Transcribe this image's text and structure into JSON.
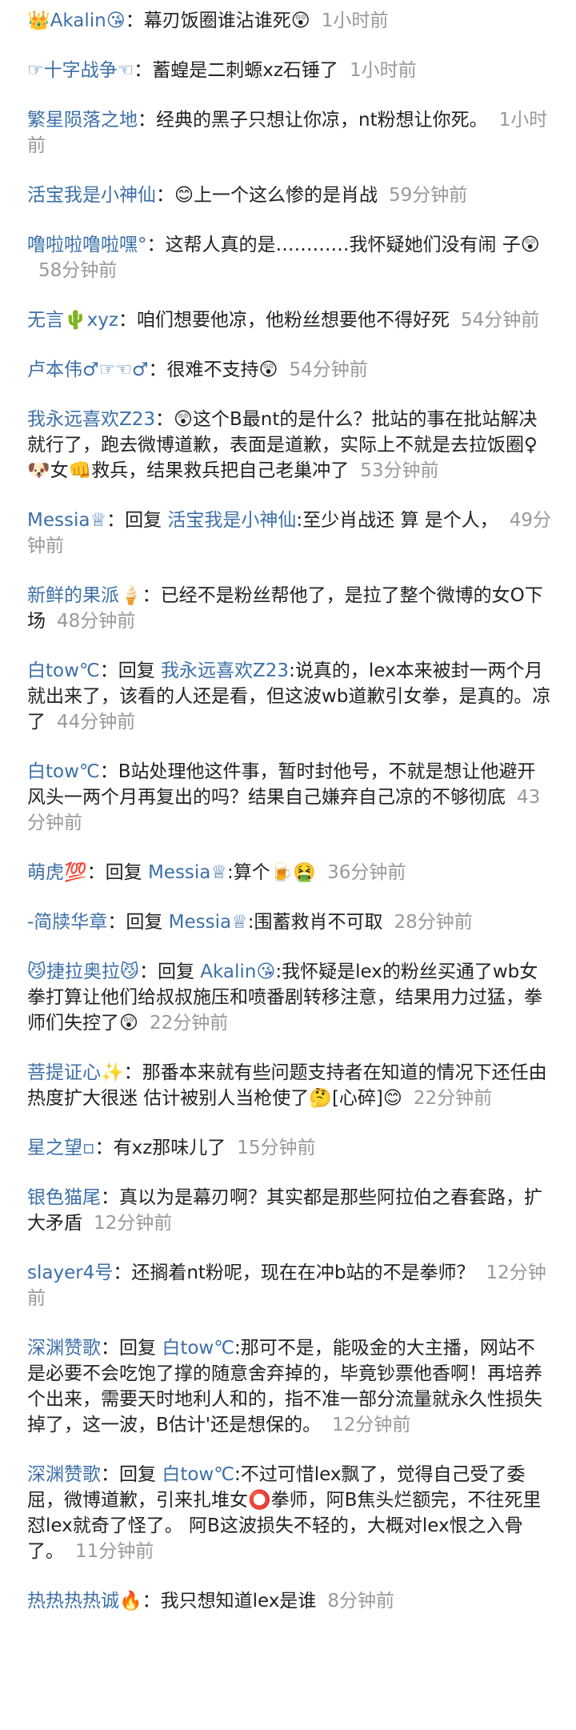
{
  "comments": [
    {
      "name": "👑Akalin😘",
      "sep": "：",
      "reply_label": "",
      "reply_to": "",
      "text": "幕刃饭圈谁沾谁死😲",
      "time": "1小时前"
    },
    {
      "name": "☞十字战争☜",
      "sep": "：",
      "reply_label": "",
      "reply_to": "",
      "text": "蓄蝗是二刺螈xz石锤了",
      "time": "1小时前"
    },
    {
      "name": "繁星陨落之地",
      "sep": "：",
      "reply_label": "",
      "reply_to": "",
      "text": "经典的黑子只想让你凉，nt粉想让你死。",
      "time": "1小时前"
    },
    {
      "name": "活宝我是小神仙",
      "sep": "：",
      "reply_label": "",
      "reply_to": "",
      "text": "😊上一个这么惨的是肖战",
      "time": "59分钟前"
    },
    {
      "name": "噜啦啦噜啦嘿°",
      "sep": "：",
      "reply_label": "",
      "reply_to": "",
      "text": "这帮人真的是…………我怀疑她们没有闹 子😲",
      "time": "58分钟前"
    },
    {
      "name": "无言🌵xyz",
      "sep": "：",
      "reply_label": "",
      "reply_to": "",
      "text": "咱们想要他凉，他粉丝想要他不得好死",
      "time": "54分钟前"
    },
    {
      "name": "卢本伟♂☞☜♂",
      "sep": "：",
      "reply_label": "",
      "reply_to": "",
      "text": "很难不支持😲",
      "time": "54分钟前"
    },
    {
      "name": "我永远喜欢Z23",
      "sep": "：",
      "reply_label": "",
      "reply_to": "",
      "text": "😲这个B最nt的是什么？批站的事在批站解决就行了，跑去微博道歉，表面是道歉，实际上不就是去拉饭圈♀🐶女👊救兵，结果救兵把自己老巢冲了",
      "time": "53分钟前"
    },
    {
      "name": "Messia♕",
      "sep": "：",
      "reply_label": "回复 ",
      "reply_to": "活宝我是小神仙",
      "text": ":至少肖战还 算 是个人，",
      "time": "49分钟前"
    },
    {
      "name": "新鲜的果派🍦",
      "sep": "：",
      "reply_label": "",
      "reply_to": "",
      "text": "已经不是粉丝帮他了，是拉了整个微博的女O下场",
      "time": "48分钟前"
    },
    {
      "name": "白tow℃",
      "sep": "：",
      "reply_label": "回复 ",
      "reply_to": "我永远喜欢Z23",
      "text": ":说真的，lex本来被封一两个月就出来了，该看的人还是看，但这波wb道歉引女拳，是真的。凉了",
      "time": "44分钟前"
    },
    {
      "name": "白tow℃",
      "sep": "：",
      "reply_label": "",
      "reply_to": "",
      "text": "B站处理他这件事，暂时封他号，不就是想让他避开风头一两个月再复出的吗？结果自己嫌弃自己凉的不够彻底",
      "time": "43分钟前"
    },
    {
      "name": "萌虎💯",
      "sep": "：",
      "reply_label": "回复 ",
      "reply_to": "Messia♕",
      "text": ":算个🍺🤮",
      "time": "36分钟前"
    },
    {
      "name": "-简牍华章",
      "sep": "：",
      "reply_label": "回复 ",
      "reply_to": "Messia♕",
      "text": ":围蓄救肖不可取",
      "time": "28分钟前"
    },
    {
      "name": "😼捷拉奥拉😼",
      "sep": "：",
      "reply_label": "回复 ",
      "reply_to": "Akalin😘",
      "text": ":我怀疑是lex的粉丝买通了wb女拳打算让他们给叔叔施压和喷番剧转移注意，结果用力过猛，拳师们失控了😲",
      "time": "22分钟前"
    },
    {
      "name": "菩提证心✨",
      "sep": "：",
      "reply_label": "",
      "reply_to": "",
      "text": "那番本来就有些问题支持者在知道的情况下还任由热度扩大很迷 估计被别人当枪使了🤔[心碎]😊",
      "time": "22分钟前"
    },
    {
      "name": "星之望▫",
      "sep": "：",
      "reply_label": "",
      "reply_to": "",
      "text": "有xz那味儿了",
      "time": "15分钟前"
    },
    {
      "name": "银色猫尾",
      "sep": "：",
      "reply_label": "",
      "reply_to": "",
      "text": "真以为是幕刃啊？其实都是那些阿拉伯之春套路，扩大矛盾",
      "time": "12分钟前"
    },
    {
      "name": "slayer4号",
      "sep": "：",
      "reply_label": "",
      "reply_to": "",
      "text": "还搁着nt粉呢，现在在冲b站的不是拳师？",
      "time": "12分钟前"
    },
    {
      "name": "深渊赞歌",
      "sep": "：",
      "reply_label": "回复 ",
      "reply_to": "白tow℃",
      "text": ":那可不是，能吸金的大主播，网站不是必要不会吃饱了撑的随意舍弃掉的，毕竟钞票他香啊！再培养个出来，需要天时地利人和的，指不准一部分流量就永久性损失掉了，这一波，B估计'还是想保的。",
      "time": "12分钟前"
    },
    {
      "name": "深渊赞歌",
      "sep": "：",
      "reply_label": "回复 ",
      "reply_to": "白tow℃",
      "text": ":不过可惜lex飘了，觉得自己受了委屈，微博道歉，引来扎堆女⭕拳师，阿B焦头烂额完，不往死里怼lex就奇了怪了。 阿B这波损失不轻的，大概对lex恨之入骨了。",
      "time": "11分钟前"
    },
    {
      "name": "热热热热诚🔥",
      "sep": "：",
      "reply_label": "",
      "reply_to": "",
      "text": "我只想知道lex是谁",
      "time": "8分钟前"
    }
  ]
}
